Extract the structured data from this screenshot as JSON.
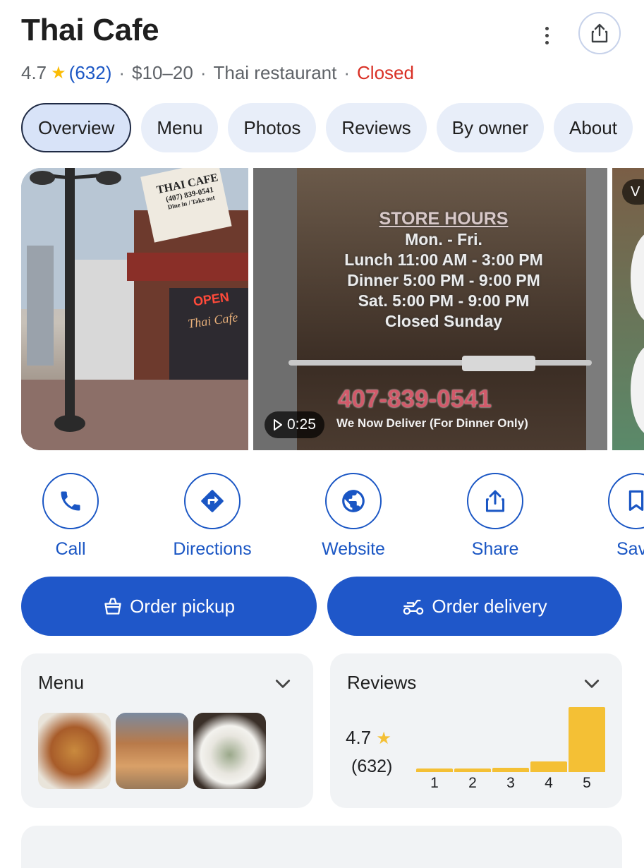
{
  "place": {
    "name": "Thai Cafe",
    "rating": "4.7",
    "review_count": "(632)",
    "price": "$10–20",
    "category": "Thai restaurant",
    "status": "Closed",
    "separator": "·"
  },
  "tabs": [
    {
      "label": "Overview",
      "active": true
    },
    {
      "label": "Menu"
    },
    {
      "label": "Photos"
    },
    {
      "label": "Reviews"
    },
    {
      "label": "By owner"
    },
    {
      "label": "About"
    }
  ],
  "photos": {
    "sign": {
      "line1": "THAI CAFE",
      "line2": "(407) 839-0541",
      "line3": "Dine in / Take out",
      "neon": "OPEN",
      "window": "Thai Cafe"
    },
    "door": {
      "heading": "STORE HOURS",
      "lines": [
        "Mon. - Fri.",
        "Lunch 11:00 AM - 3:00 PM",
        "Dinner 5:00 PM - 9:00 PM",
        "Sat. 5:00 PM - 9:00 PM",
        "Closed Sunday"
      ],
      "phone": "407-839-0541",
      "note": "We Now Deliver (For Dinner Only)"
    },
    "video_duration": "0:25",
    "third_badge": "V"
  },
  "actions": [
    {
      "label": "Call",
      "icon": "phone-icon"
    },
    {
      "label": "Directions",
      "icon": "directions-icon"
    },
    {
      "label": "Website",
      "icon": "globe-icon"
    },
    {
      "label": "Share",
      "icon": "share-icon"
    },
    {
      "label": "Sav",
      "icon": "bookmark-icon"
    }
  ],
  "order": {
    "pickup": "Order pickup",
    "delivery": "Order delivery"
  },
  "menu_card": {
    "title": "Menu"
  },
  "reviews_card": {
    "title": "Reviews",
    "rating": "4.7",
    "count": "(632)",
    "distribution": [
      {
        "stars": "1",
        "fraction": 0.05
      },
      {
        "stars": "2",
        "fraction": 0.05
      },
      {
        "stars": "3",
        "fraction": 0.06
      },
      {
        "stars": "4",
        "fraction": 0.16
      },
      {
        "stars": "5",
        "fraction": 1.0
      }
    ]
  },
  "colors": {
    "accent": "#1f57c9",
    "link": "#1a56c4",
    "closed": "#d93025",
    "star": "#fbbc04",
    "bar": "#f4c035"
  }
}
